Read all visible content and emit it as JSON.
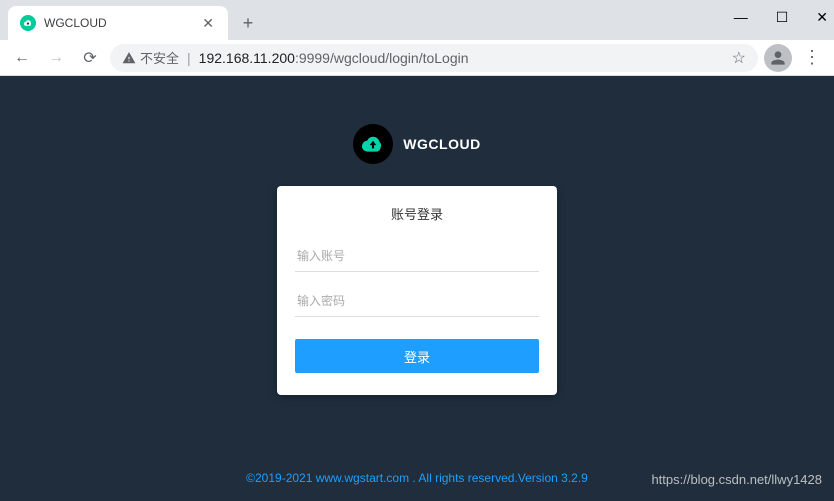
{
  "browser": {
    "tab_title": "WGCLOUD",
    "security_label": "不安全",
    "url_host": "192.168.11.200",
    "url_port_path": ":9999/wgcloud/login/toLogin"
  },
  "brand": {
    "name": "WGCLOUD"
  },
  "login": {
    "title": "账号登录",
    "username_placeholder": "输入账号",
    "password_placeholder": "输入密码",
    "submit_label": "登录"
  },
  "footer": {
    "text": "©2019-2021 www.wgstart.com . All rights reserved.Version 3.2.9"
  },
  "watermark": {
    "text": "https://blog.csdn.net/llwy1428"
  }
}
